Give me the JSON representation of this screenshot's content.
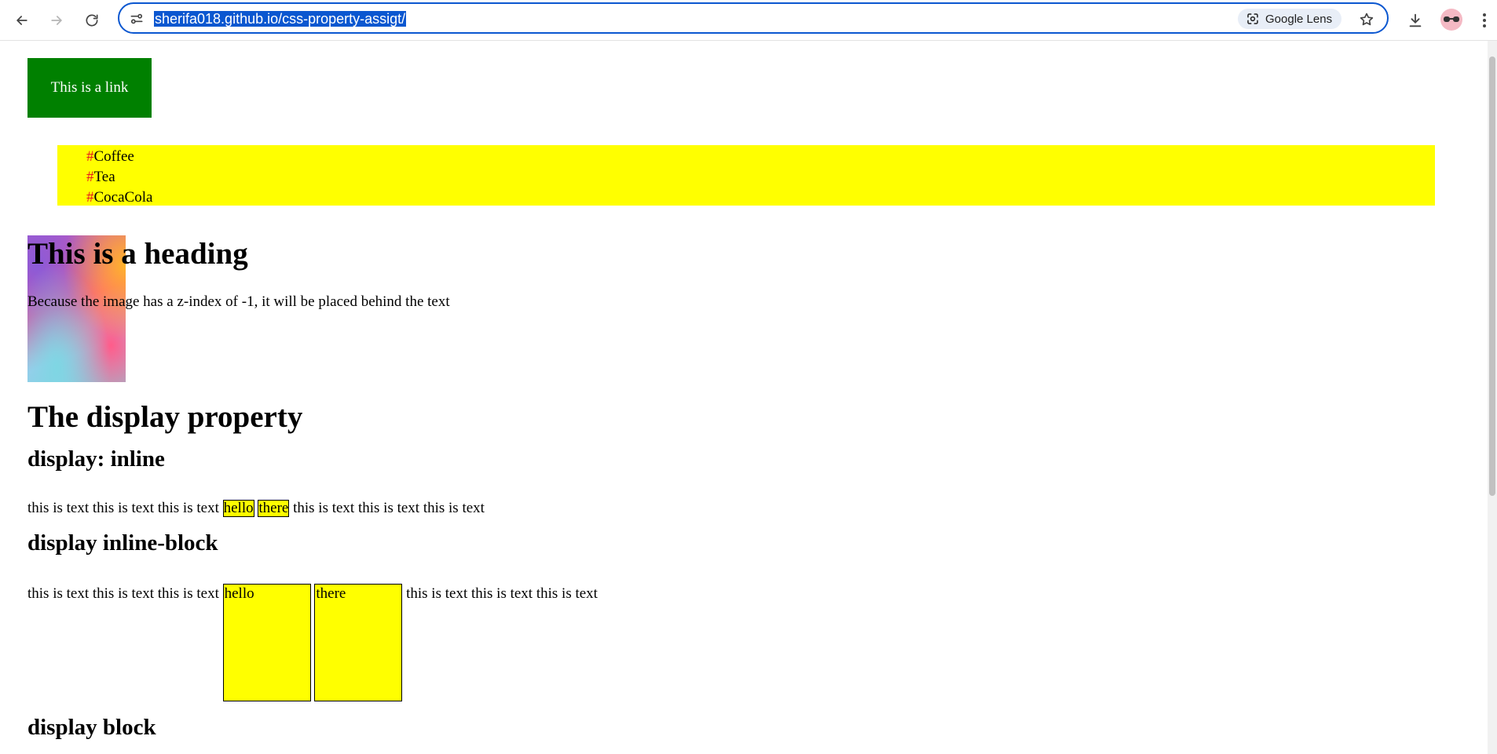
{
  "browser": {
    "url": "sherifa018.github.io/css-property-assigt/",
    "lens_label": "Google Lens"
  },
  "page": {
    "link_text": "This is a link",
    "list_marker": "#",
    "drinks": [
      "Coffee",
      "Tea",
      "CocaCola"
    ],
    "heading": "This is a heading",
    "z_index_text": "Because the image has a z-index of -1, it will be placed behind the text",
    "display_heading": "The display property",
    "inline_heading": "display: inline",
    "inline_block_heading": "display inline-block",
    "block_heading": "display block",
    "filler_text": "this is text this is text this is text",
    "box_hello": "hello",
    "box_there": "there"
  },
  "colors": {
    "link_bg": "#008000",
    "list_bg": "#ffff00",
    "marker": "#e81c1c",
    "box_bg": "#ffff00",
    "focus_ring": "#0b57d0"
  }
}
